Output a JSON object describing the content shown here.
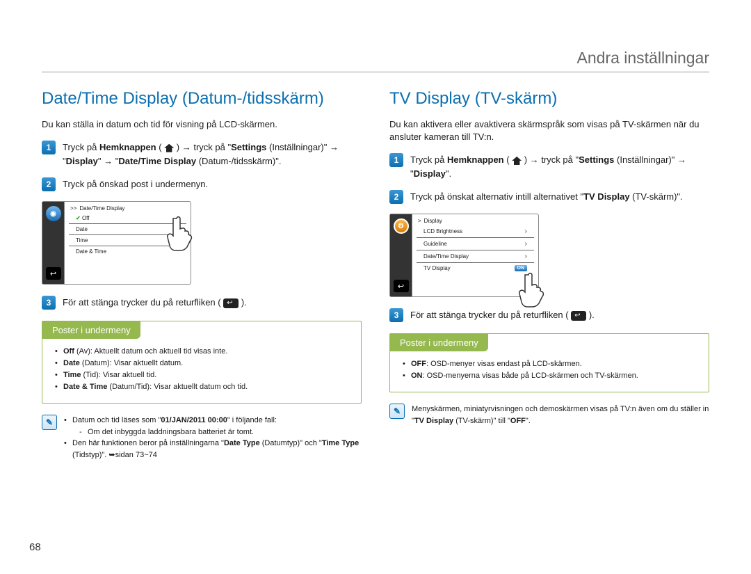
{
  "header": {
    "title": "Andra inställningar"
  },
  "page_number": "68",
  "left": {
    "title": "Date/Time Display (Datum-/tidsskärm)",
    "intro": "Du kan ställa in datum och tid för visning på LCD-skärmen.",
    "step1_a": "Tryck på ",
    "step1_b": "Hemknappen",
    "step1_c": " ( ",
    "step1_d": " ) → tryck på \"",
    "step1_e": "Settings",
    "step1_f": " (Inställningar)\" → \"",
    "step1_g": "Display",
    "step1_h": "\" → \"",
    "step1_i": "Date/Time Display",
    "step1_j": " (Datum-/tidsskärm)\".",
    "step2": "Tryck på önskad post i undermenyn.",
    "step3_a": "För att stänga trycker du på returfliken ( ",
    "step3_b": " ).",
    "screen": {
      "breadcrumb_arrow": ">>",
      "breadcrumb": "Date/Time Display",
      "items": [
        "Off",
        "Date",
        "Time",
        "Date & Time"
      ]
    },
    "submenu": {
      "header": "Poster i undermeny",
      "items": [
        {
          "b": "Off",
          "rest": " (Av): Aktuellt datum och aktuell tid visas inte."
        },
        {
          "b": "Date",
          "rest": " (Datum): Visar aktuellt datum."
        },
        {
          "b": "Time",
          "rest": " (Tid): Visar aktuell tid."
        },
        {
          "b": "Date & Time",
          "rest": " (Datum/Tid): Visar aktuellt datum och tid."
        }
      ]
    },
    "note": {
      "line1_a": "Datum och tid läses som \"",
      "line1_b": "01/JAN/2011 00:00",
      "line1_c": "\" i följande fall:",
      "sub1": "Om det inbyggda laddningsbara batteriet är tomt.",
      "line2_a": "Den här funktionen beror på inställningarna \"",
      "line2_b": "Date Type",
      "line2_c": " (Datumtyp)\" och \"",
      "line2_d": "Time Type",
      "line2_e": " (Tidstyp)\". ➥sidan 73~74"
    }
  },
  "right": {
    "title": "TV Display (TV-skärm)",
    "intro": "Du kan aktivera eller avaktivera skärmspråk som visas på TV-skärmen när du ansluter kameran till TV:n.",
    "step1_a": "Tryck på ",
    "step1_b": "Hemknappen",
    "step1_c": " ( ",
    "step1_d": " ) → tryck på \"",
    "step1_e": "Settings",
    "step1_f": " (Inställningar)\" → \"",
    "step1_g": "Display",
    "step1_h": "\".",
    "step2_a": "Tryck på önskat alternativ intill alternativet \"",
    "step2_b": "TV Display",
    "step2_c": " (TV-skärm)\".",
    "step3_a": "För att stänga trycker du på returfliken ( ",
    "step3_b": " ).",
    "screen": {
      "breadcrumb_arrow": ">",
      "breadcrumb": "Display",
      "items": [
        "LCD Brightness",
        "Guideline",
        "Date/Time Display",
        "TV Display"
      ],
      "on_label": "ON"
    },
    "submenu": {
      "header": "Poster i undermeny",
      "items": [
        {
          "b": "OFF",
          "rest": ": OSD-menyer visas endast på LCD-skärmen."
        },
        {
          "b": "ON",
          "rest": ": OSD-menyerna visas både på LCD-skärmen och TV-skärmen."
        }
      ]
    },
    "note": {
      "text_a": "Menyskärmen, miniatyrvisningen och demoskärmen visas på TV:n även om du ställer in \"",
      "text_b": "TV Display",
      "text_c": " (TV-skärm)\" till \"",
      "text_d": "OFF",
      "text_e": "\"."
    }
  }
}
